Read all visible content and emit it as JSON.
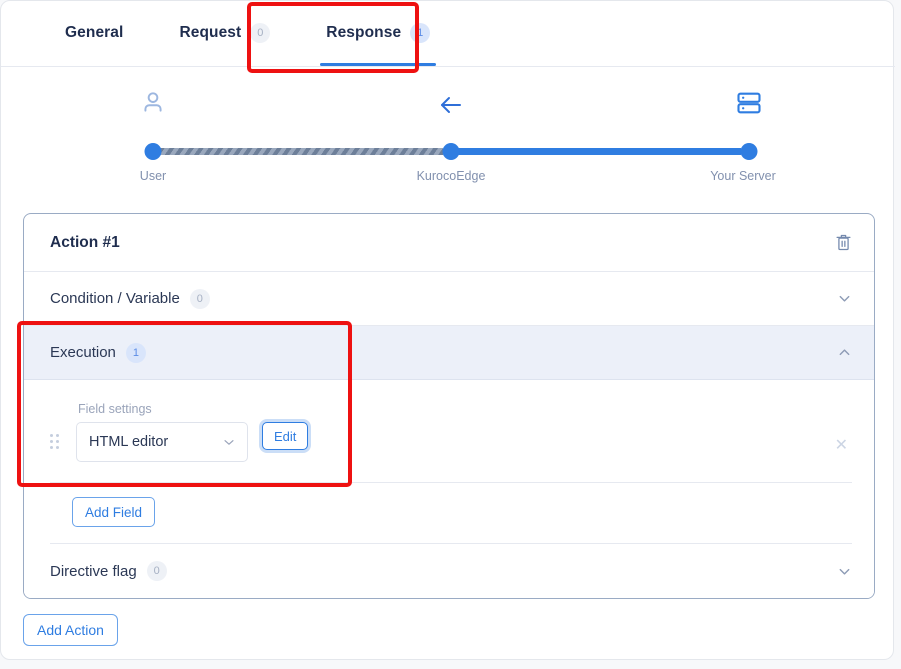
{
  "tabs": [
    {
      "label": "General",
      "badge": null,
      "active": false
    },
    {
      "label": "Request",
      "badge": "0",
      "active": false
    },
    {
      "label": "Response",
      "badge": "1",
      "active": true
    }
  ],
  "flow": {
    "nodes": [
      {
        "label": "User",
        "icon": "user-icon"
      },
      {
        "label": "KurocoEdge",
        "icon": "arrow-left-icon"
      },
      {
        "label": "Your Server",
        "icon": "server-icon"
      }
    ],
    "direction_arrow": "←"
  },
  "action": {
    "title": "Action #1",
    "delete_icon": "trash-icon",
    "sections": [
      {
        "name": "condition-variable",
        "title": "Condition / Variable",
        "badge": "0",
        "open": false,
        "chevron": "chevron-down-icon"
      },
      {
        "name": "execution",
        "title": "Execution",
        "badge": "1",
        "open": true,
        "chevron": "chevron-up-icon"
      },
      {
        "name": "directive-flag",
        "title": "Directive flag",
        "badge": "0",
        "open": false,
        "chevron": "chevron-down-icon"
      }
    ],
    "field": {
      "label": "Field settings",
      "value": "HTML editor",
      "edit_label": "Edit",
      "remove_icon": "close-icon",
      "drag_icon": "drag-handle-icon"
    },
    "add_field_label": "Add Field"
  },
  "add_action_label": "Add Action",
  "colors": {
    "accent": "#2f7de1",
    "annotation": "#ee1111",
    "section_active_bg": "#ecf0f9",
    "badge_active_bg": "#d9e5fb",
    "badge_muted_bg": "#eef1f6"
  }
}
